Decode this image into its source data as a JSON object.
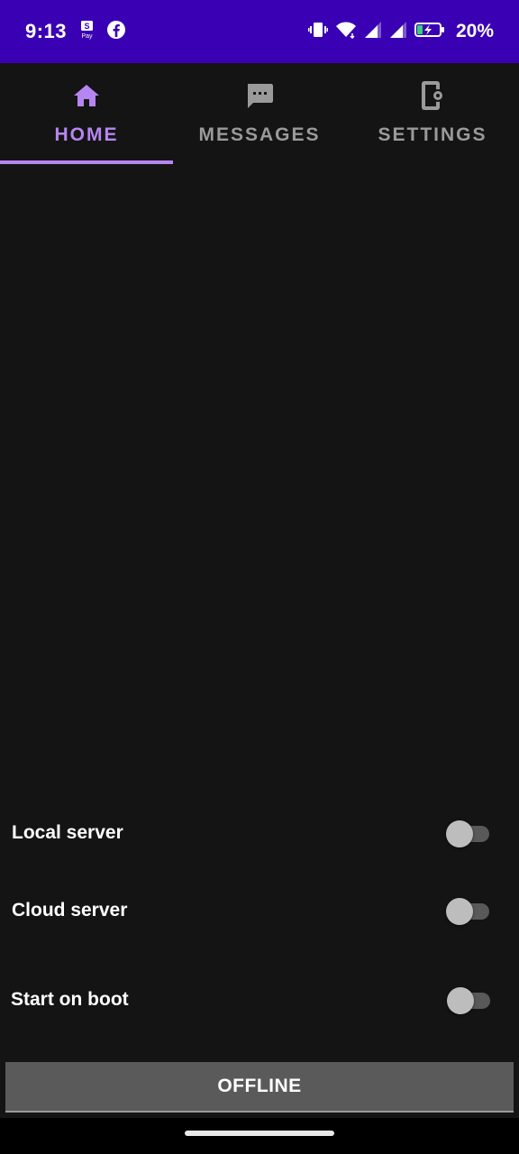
{
  "status_bar": {
    "time": "9:13",
    "battery_percent": "20%",
    "left_icons": [
      "pay-icon",
      "facebook-icon"
    ],
    "right_icons": [
      "vibrate-icon",
      "wifi-icon",
      "signal-icon",
      "signal-icon",
      "battery-charging-icon"
    ]
  },
  "tabs": [
    {
      "label": "HOME",
      "icon": "home-icon",
      "active": true
    },
    {
      "label": "MESSAGES",
      "icon": "message-icon",
      "active": false
    },
    {
      "label": "SETTINGS",
      "icon": "settings-phone-icon",
      "active": false
    }
  ],
  "settings": {
    "local_server": {
      "label": "Local server",
      "enabled": false
    },
    "cloud_server": {
      "label": "Cloud server",
      "enabled": false
    },
    "start_on_boot": {
      "label": "Start on boot",
      "enabled": false
    }
  },
  "status_button": {
    "label": "OFFLINE"
  },
  "colors": {
    "status_bar": "#3a00b4",
    "background": "#141414",
    "accent": "#b586f2",
    "inactive_tab": "#9a9a9a",
    "button_bg": "#5a5a5a"
  }
}
